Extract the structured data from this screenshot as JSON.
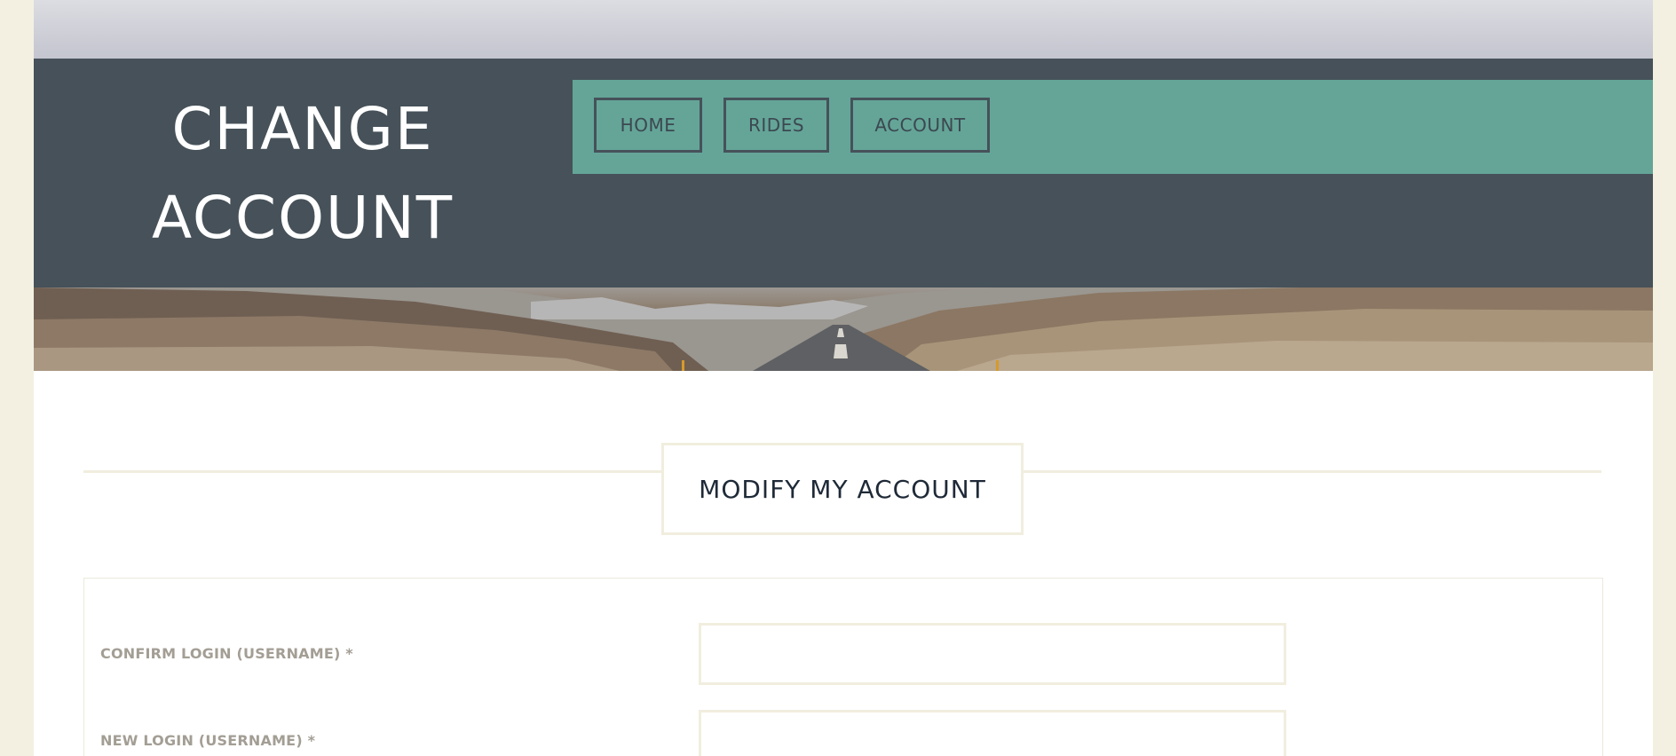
{
  "header": {
    "title_line1": "CHANGE",
    "title_line2": "ACCOUNT"
  },
  "nav": {
    "items": [
      {
        "label": "HOME"
      },
      {
        "label": "RIDES"
      },
      {
        "label": "ACCOUNT"
      }
    ]
  },
  "section": {
    "heading": "MODIFY MY ACCOUNT"
  },
  "form": {
    "fields": [
      {
        "label": "CONFIRM LOGIN (USERNAME) *",
        "value": "",
        "placeholder": ""
      },
      {
        "label": "NEW LOGIN (USERNAME) *",
        "value": "",
        "placeholder": ""
      }
    ]
  },
  "colors": {
    "page_background": "#f3f0e2",
    "header_band": "#465159",
    "nav_bar": "#64a598",
    "nav_border": "#465159",
    "heading_text": "#1f2a38",
    "label_text": "#a39e94",
    "input_border": "#f1eedf"
  },
  "icons": {
    "hero": "road-landscape-image"
  }
}
